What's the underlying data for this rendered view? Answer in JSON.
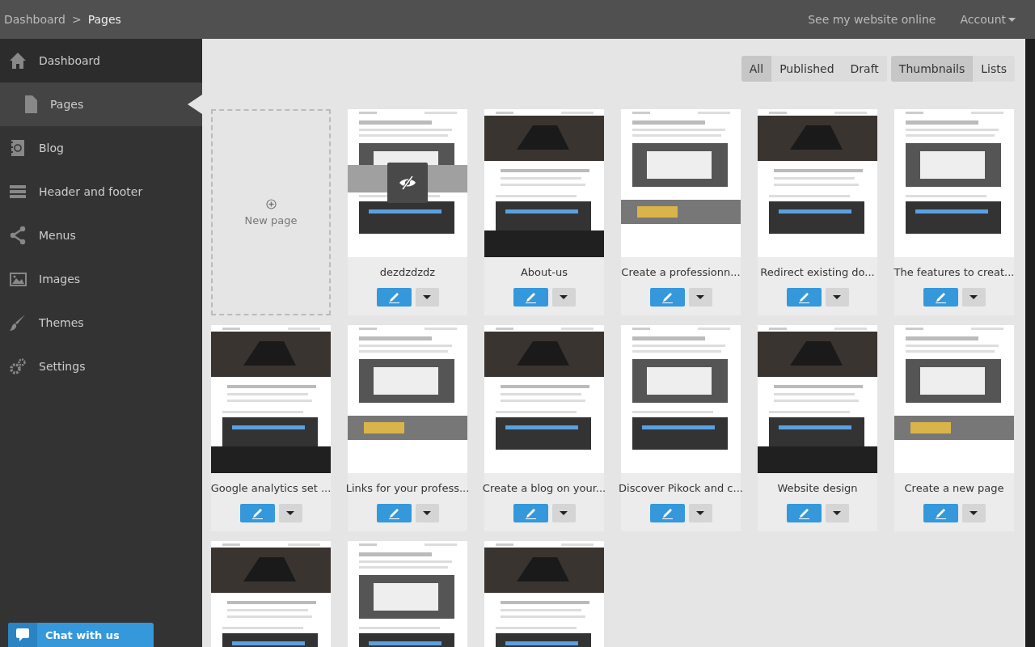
{
  "header": {
    "breadcrumb": [
      {
        "label": "Dashboard",
        "current": false
      },
      {
        "label": "Pages",
        "current": true
      }
    ],
    "separator": ">",
    "links": [
      "See my website online",
      "Account"
    ]
  },
  "sidebar": {
    "items": [
      {
        "label": "Dashboard",
        "selected": false,
        "children": [
          {
            "label": "Pages",
            "selected": true
          }
        ]
      },
      {
        "label": "Blog",
        "selected": false
      },
      {
        "label": "Header and footer",
        "selected": false
      },
      {
        "label": "Menus",
        "selected": false
      },
      {
        "label": "Images",
        "selected": false
      },
      {
        "label": "Themes",
        "selected": false
      },
      {
        "label": "Settings",
        "selected": false
      }
    ]
  },
  "filters": [
    [
      {
        "label": "All",
        "selected": true
      },
      {
        "label": "Published",
        "selected": false
      },
      {
        "label": "Draft",
        "selected": false
      }
    ],
    [
      {
        "label": "Thumbnails",
        "selected": true
      },
      {
        "label": "Lists",
        "selected": false
      }
    ]
  ],
  "new_page": {
    "label": "New page"
  },
  "pages": [
    {
      "title": "dezdzdzdz",
      "hidden": true
    },
    {
      "title": "About-us",
      "hidden": false
    },
    {
      "title": "Create a professionn...",
      "hidden": false
    },
    {
      "title": "Redirect existing do...",
      "hidden": false
    },
    {
      "title": "The features to creat...",
      "hidden": false
    },
    {
      "title": "Google analytics set ...",
      "hidden": false
    },
    {
      "title": "Links for your profess...",
      "hidden": false
    },
    {
      "title": "Create a blog on your...",
      "hidden": false
    },
    {
      "title": "Discover Pikock and c...",
      "hidden": false
    },
    {
      "title": "Website design",
      "hidden": false
    },
    {
      "title": "Create a new page",
      "hidden": false
    },
    {
      "hidden": false
    },
    {
      "hidden": false
    },
    {
      "hidden": false
    }
  ],
  "chat": {
    "label": "Chat with us"
  }
}
